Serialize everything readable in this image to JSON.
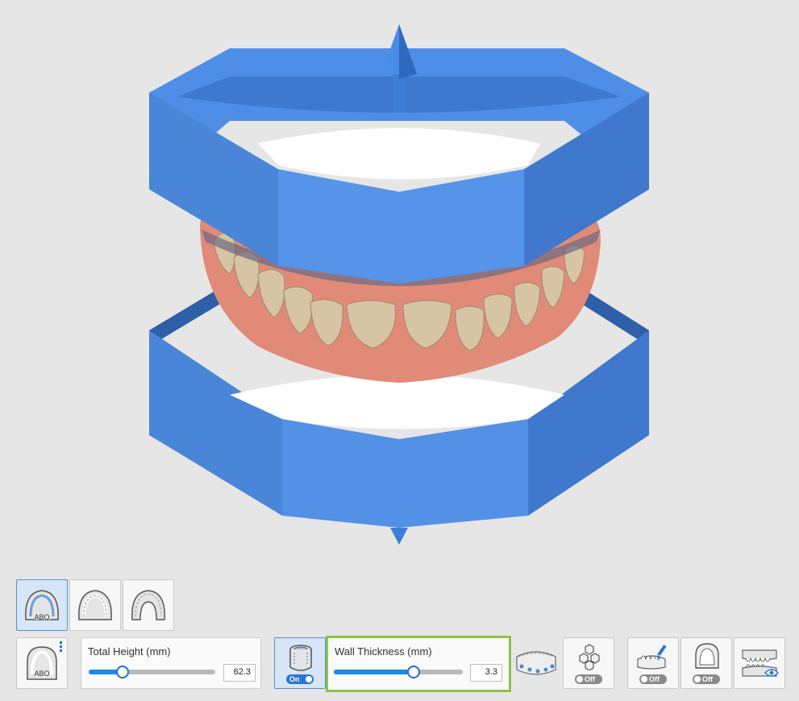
{
  "arch_view_buttons": [
    {
      "id": "abo",
      "icon": "abo-arch-icon",
      "badge": "ABO",
      "active": true
    },
    {
      "id": "maxilla",
      "icon": "maxilla-arch-icon",
      "active": false
    },
    {
      "id": "mandible",
      "icon": "mandible-arch-icon",
      "active": false
    }
  ],
  "base_type_button": {
    "icon": "abo-base-icon",
    "badge": "ABO",
    "menu_icon": "more-vertical-icon"
  },
  "total_height": {
    "label": "Total Height (mm)",
    "value": "62.3",
    "fraction": 0.27
  },
  "hollow_button": {
    "icon": "hollow-cylinder-icon",
    "toggle_label": "On",
    "state": "on"
  },
  "wall_thickness": {
    "label": "Wall Thickness (mm)",
    "value": "3.3",
    "fraction": 0.62,
    "highlight_color": "#8bc34a"
  },
  "tools": [
    {
      "id": "base-pins",
      "icon": "base-pins-icon"
    },
    {
      "id": "honeycomb",
      "icon": "honeycomb-icon",
      "toggle_label": "Off",
      "state": "off"
    },
    {
      "id": "trim-brush",
      "icon": "trim-brush-icon",
      "toggle_label": "Off",
      "state": "off"
    },
    {
      "id": "palate",
      "icon": "palate-icon",
      "toggle_label": "Off",
      "state": "off"
    },
    {
      "id": "preview",
      "icon": "preview-eye-icon"
    }
  ],
  "colors": {
    "base_blue": "#4e8fe3",
    "base_blue_dark": "#3569b8",
    "gum": "#e28a78",
    "tooth": "#d8c6a6",
    "accent": "#1e88e5"
  }
}
